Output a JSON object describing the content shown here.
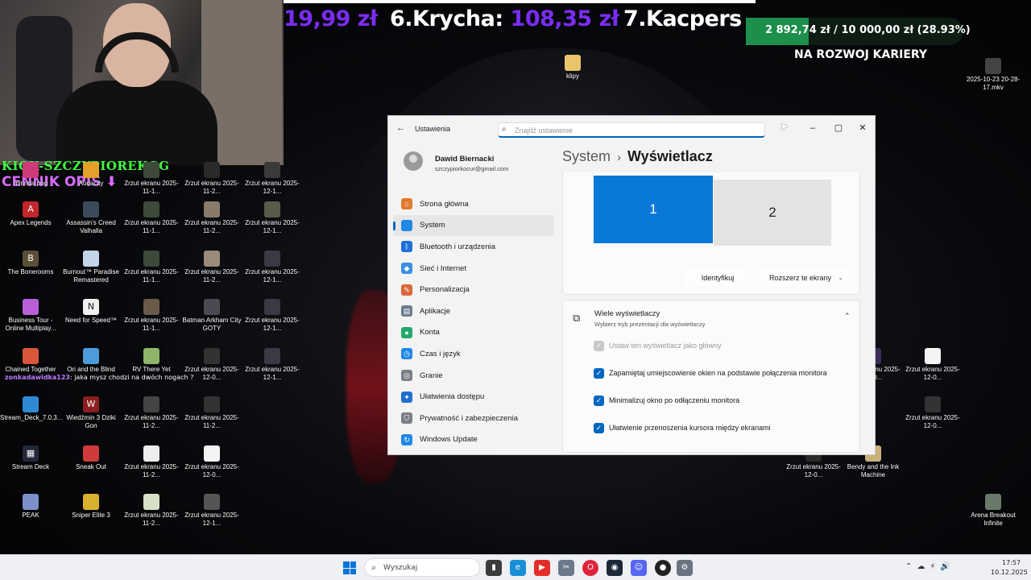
{
  "stream_overlay": {
    "ticker": {
      "item1": "19,99 zł",
      "item2_prefix": "6.Krycha: ",
      "item2_value": "108,35 zł",
      "item3": "7.Kacpers"
    },
    "goal": {
      "text": "2 892,74 zł / 10 000,00 zł (28.93%)",
      "progress": 0.2893,
      "caption": "NA ROZWOJ KARIERY"
    },
    "kick": "KICK-SZCZYPIOREKGG",
    "cennik": "CENNIK OPIS ⬇",
    "chat": {
      "user": "zonkadawidka123",
      "message": ": jaka mysz chodzi na dwóch nogach ?"
    }
  },
  "desktop": {
    "icons": {
      "mirinda": "mirinda.png",
      "audacity": "Audacity",
      "zrzut_1": "Zrzut ekranu 2025-11-1...",
      "zrzut_2": "Zrzut ekranu 2025-11-2...",
      "zrzut_3": "Zrzut ekranu 2025-12-1...",
      "apex": "Apex Legends",
      "assassins": "Assassin's Creed Valhalla",
      "zrzut_4": "Zrzut ekranu 2025-11-1...",
      "zrzut_5": "Zrzut ekranu 2025-11-2...",
      "zrzut_6": "Zrzut ekranu 2025-12-1...",
      "backrooms": "The Bonerooms",
      "burnout": "Burnout™ Paradise Remastered",
      "zrzut_7": "Zrzut ekranu 2025-11-1...",
      "zrzut_8": "Zrzut ekranu 2025-11-2...",
      "zrzut_9": "Zrzut ekranu 2025-12-1...",
      "business_tour": "Business Tour - Online Multiplay...",
      "nfs": "Need for Speed™",
      "zrzut_10": "Zrzut ekranu 2025-11-1...",
      "batman": "Batman Arkham City GOTY",
      "zrzut_11": "Zrzut ekranu 2025-12-1...",
      "chained": "Chained Together",
      "ori": "Ori and the Blind",
      "rv": "RV There Yet",
      "zrzut_12": "Zrzut ekranu 2025-12-0...",
      "zrzut_13": "Zrzut ekranu 2025-12-1...",
      "stream_deck_setup": "Stream_Deck_7.0.3...",
      "wiedzmin": "Wiedźmin 3 Dziki Gon",
      "zrzut_14": "Zrzut ekranu 2025-11-2...",
      "zrzut_15": "Zrzut ekranu 2025-11-2...",
      "stream_deck": "Stream Deck",
      "sneak_out": "Sneak Out",
      "zrzut_16": "Zrzut ekranu 2025-11-2...",
      "zrzut_17": "Zrzut ekranu 2025-12-0...",
      "peak": "PEAK",
      "sniper": "Sniper Elite 3",
      "zrzut_18": "Zrzut ekranu 2025-11-2...",
      "zrzut_19": "Zrzut ekranu 2025-12-1...",
      "klipy": "klipy",
      "mkv": "2025-10-23 20-28-17.mkv",
      "zrzut_r1": "Zrzut ekranu 2025-12-0...",
      "zrzut_r2": "Zrzut ekranu 2025-12-0...",
      "zrzut_r3": "Zrzut ekranu 2025-12-0...",
      "zrzut_r4": "Zrzut ekranu 2025-12-0...",
      "bendy": "Bendy and the Ink Machine",
      "arena": "Arena Breakout Infinite"
    }
  },
  "settings": {
    "window_title": "Ustawienia",
    "search_placeholder": "Znajdź ustawienie",
    "profile": {
      "name": "Dawid Biernacki",
      "email": "szczypiorkocur@gmail.com"
    },
    "nav": [
      {
        "label": "Strona główna",
        "icon": "home-icon",
        "color": "#e07a2e"
      },
      {
        "label": "System",
        "icon": "system-icon",
        "color": "#1f88e5"
      },
      {
        "label": "Bluetooth i urządzenia",
        "icon": "bluetooth-icon",
        "color": "#1e6fd9"
      },
      {
        "label": "Sieć i Internet",
        "icon": "network-icon",
        "color": "#3a8fe0"
      },
      {
        "label": "Personalizacja",
        "icon": "brush-icon",
        "color": "#d9683a"
      },
      {
        "label": "Aplikacje",
        "icon": "apps-icon",
        "color": "#6c7b8e"
      },
      {
        "label": "Konta",
        "icon": "accounts-icon",
        "color": "#22a86a"
      },
      {
        "label": "Czas i język",
        "icon": "time-language-icon",
        "color": "#1f88e5"
      },
      {
        "label": "Granie",
        "icon": "gaming-icon",
        "color": "#7a7f88"
      },
      {
        "label": "Ułatwienia dostępu",
        "icon": "accessibility-icon",
        "color": "#1f6fd0"
      },
      {
        "label": "Prywatność i zabezpieczenia",
        "icon": "shield-icon",
        "color": "#7b7f86"
      },
      {
        "label": "Windows Update",
        "icon": "update-icon",
        "color": "#1f88e5"
      }
    ],
    "breadcrumb": {
      "parent": "System",
      "separator": "›",
      "current": "Wyświetlacz"
    },
    "monitors": {
      "primary": "1",
      "secondary": "2"
    },
    "identify_label": "Identyfikuj",
    "extend_label": "Rozszerz te ekrany",
    "multi": {
      "title": "Wiele wyświetlaczy",
      "subtitle": "Wybierz tryb prezentacji dla wyświetlaczy",
      "options": [
        {
          "label": "Ustaw ten wyświetlacz jako główny",
          "checked": true,
          "disabled": true
        },
        {
          "label": "Zapamiętaj umiejscowienie okien na podstawie połączenia monitora",
          "checked": true,
          "disabled": false
        },
        {
          "label": "Minimalizuj okno po odłączeniu monitora",
          "checked": true,
          "disabled": false
        },
        {
          "label": "Ułatwienie przenoszenia kursora między ekranami",
          "checked": true,
          "disabled": false
        }
      ]
    }
  },
  "taskbar": {
    "search_label": "Wyszukaj",
    "time": "17:57",
    "date": "10.12.2025"
  }
}
